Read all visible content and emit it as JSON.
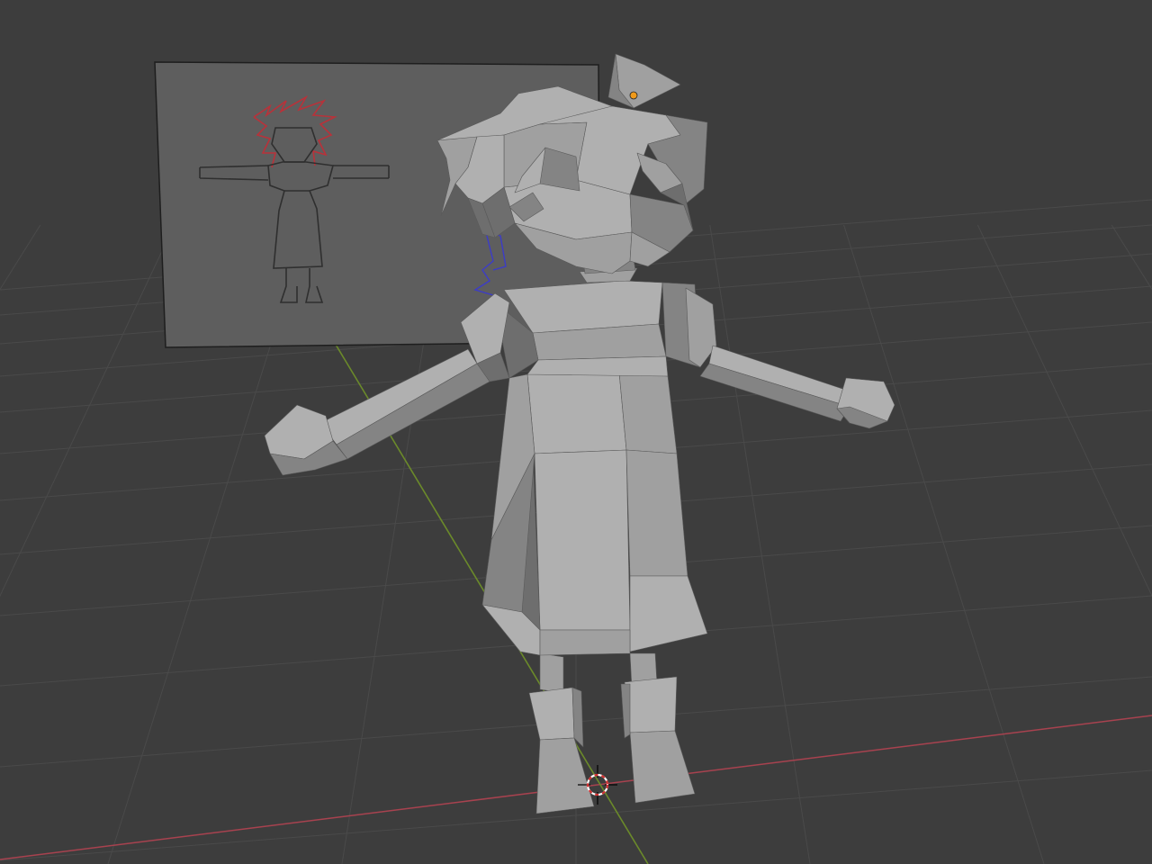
{
  "viewport": {
    "background": "#3d3d3d",
    "grid_color": "#4a4a4a",
    "x_axis_color": "#a8424f",
    "y_axis_color": "#6b8a2a"
  },
  "model": {
    "shade_light": "#b0b0b0",
    "shade_mid": "#a0a0a0",
    "shade_dark": "#848484",
    "shade_shadow": "#6e6e6e"
  },
  "reference_image": {
    "fill": "#5e5e5e",
    "sketch_hair_color": "#b8323a",
    "sketch_line_color": "#2f2f2f",
    "rig_color": "#3c3cc8"
  },
  "gizmos": {
    "origin_dot_color": "#f09a1a",
    "cursor_icon": "3d-cursor-icon"
  }
}
